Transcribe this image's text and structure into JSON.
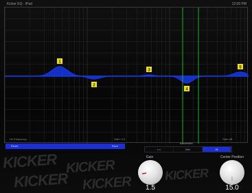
{
  "status": {
    "left": "Kicker EQ · iPad",
    "right": "12:00 PM"
  },
  "eq": {
    "footer_left": "Hz Frequency",
    "footer_mid": "Gain: 0.0",
    "footer_right": "Gain dB",
    "bands": [
      {
        "id": "band-1",
        "freq_label": "1"
      },
      {
        "id": "band-2",
        "freq_label": "2"
      },
      {
        "id": "band-3",
        "freq_label": "3"
      },
      {
        "id": "band-4",
        "freq_label": "4"
      },
      {
        "id": "band-5",
        "freq_label": "5"
      }
    ]
  },
  "preset_strip": {
    "left_label": "Reset",
    "right_label": "Save"
  },
  "bandwidth": {
    "label": "Bandwidth",
    "options": [
      "Lo",
      "Mid",
      "Hi"
    ],
    "selected_index": 2
  },
  "brand_text": "KICKER",
  "knobs": {
    "gain": {
      "label": "Gain",
      "value": "1.5"
    },
    "center_freq": {
      "label": "Center Position",
      "value": "15.0"
    }
  },
  "colors": {
    "accent": "#1a2fd6",
    "curve": "#1537e6",
    "marker": "#f2e300",
    "cursor": "#18b52a"
  }
}
